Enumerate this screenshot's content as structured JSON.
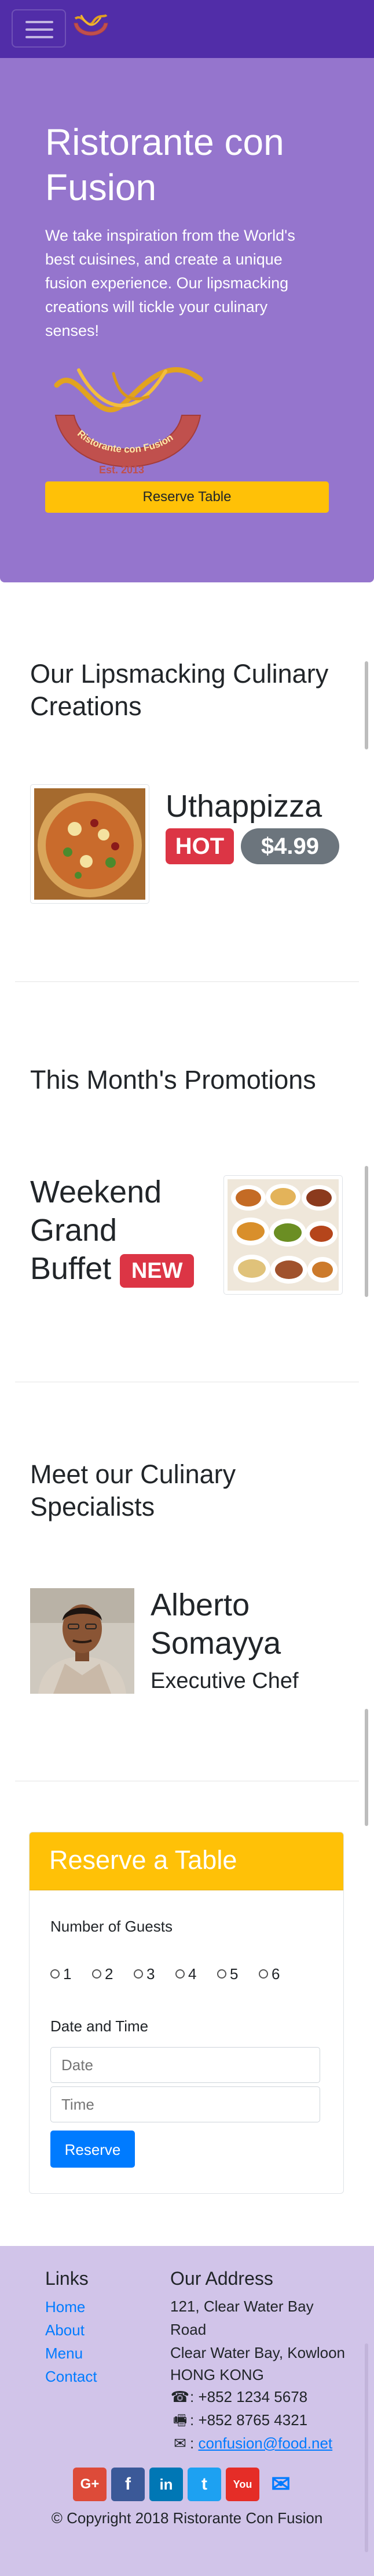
{
  "navbar": {
    "toggler_icon": "hamburger-icon",
    "logo_icon": "restaurant-logo-icon"
  },
  "jumbotron": {
    "title": "Ristorante con Fusion",
    "text": "We take inspiration from the World's best cuisines, and create a unique fusion experience. Our lipsmacking creations will tickle your culinary senses!",
    "logo_text": "Ristorante con Fusion",
    "logo_est": "Est. 2013",
    "reserve_label": "Reserve Table"
  },
  "dish": {
    "section_title": "Our Lipsmacking Culinary Creations",
    "name": "Uthappizza",
    "badge_hot": "HOT",
    "badge_price": "$4.99"
  },
  "promotion": {
    "section_title": "This Month's Promotions",
    "name": "Weekend Grand Buffet",
    "badge_new": "NEW"
  },
  "leader": {
    "section_title": "Meet our Culinary Specialists",
    "name": "Alberto Somayya",
    "designation": "Executive Chef"
  },
  "reserve": {
    "title": "Reserve a Table",
    "guests_label": "Number of Guests",
    "guest_options": [
      "1",
      "2",
      "3",
      "4",
      "5",
      "6"
    ],
    "datetime_label": "Date and Time",
    "date_placeholder": "Date",
    "time_placeholder": "Time",
    "submit_label": "Reserve"
  },
  "footer": {
    "links_title": "Links",
    "links": [
      "Home",
      "About",
      "Menu",
      "Contact"
    ],
    "address_title": "Our Address",
    "address_lines": [
      "121, Clear Water Bay",
      "Road",
      "Clear Water Bay, Kowloon",
      "HONG KONG"
    ],
    "phone": ": +852 1234 5678",
    "fax": ": +852 8765 4321",
    "email_prefix": ":",
    "email": "confusion@food.net",
    "social": [
      {
        "icon": "google-plus-icon",
        "glyph": "G+",
        "color": "#dd4b39"
      },
      {
        "icon": "facebook-icon",
        "glyph": "f",
        "color": "#3b5998"
      },
      {
        "icon": "linkedin-icon",
        "glyph": "in",
        "color": "#0077b5"
      },
      {
        "icon": "twitter-icon",
        "glyph": "t",
        "color": "#1da1f2"
      },
      {
        "icon": "youtube-icon",
        "glyph": "You",
        "color": "#e52d27"
      },
      {
        "icon": "mail-icon",
        "glyph": "✉",
        "color": "#007bff"
      }
    ],
    "copyright": "© Copyright 2018 Ristorante Con Fusion"
  },
  "colors": {
    "navbar": "#512da8",
    "jumbotron": "#9575cd",
    "footer": "#d1c4e9",
    "warning": "#ffc107",
    "danger": "#dc3545",
    "secondary": "#6c757d",
    "primary": "#007bff"
  }
}
